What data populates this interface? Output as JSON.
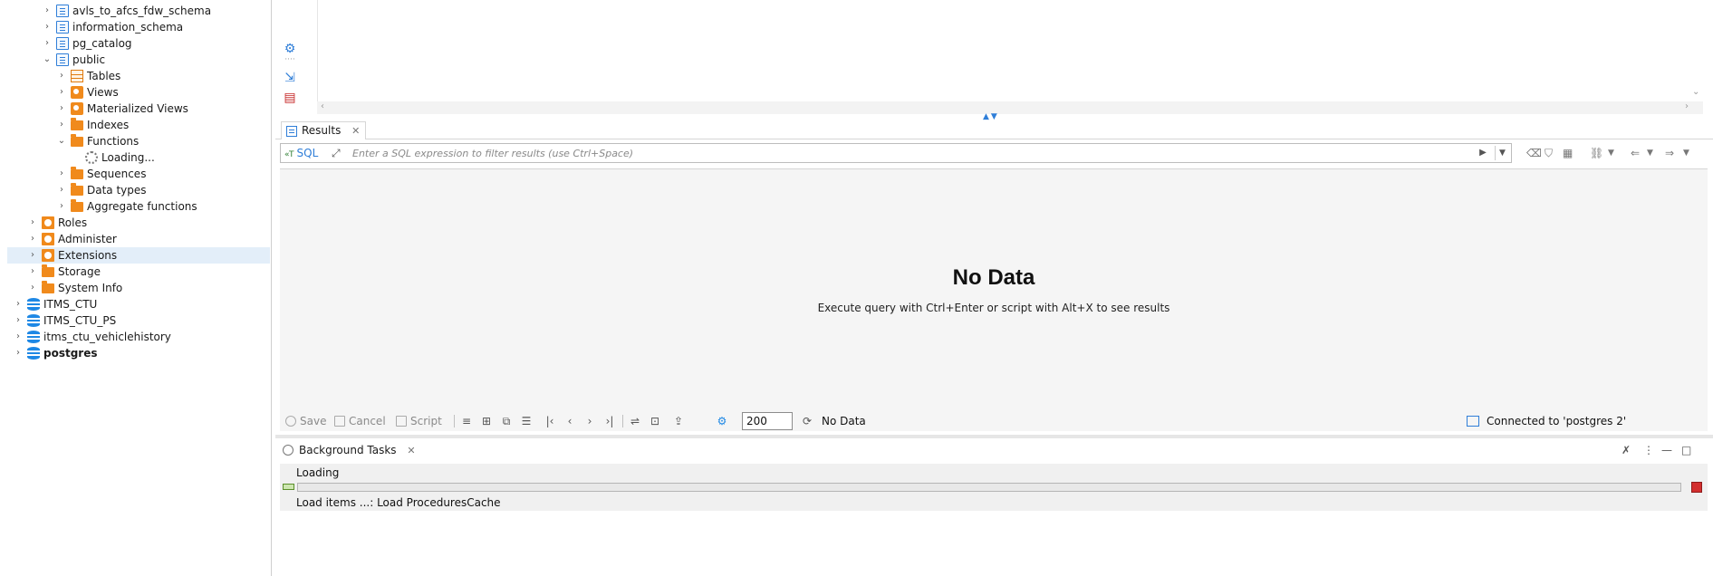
{
  "navigator": {
    "items": [
      {
        "label": "avls_to_afcs_fdw_schema",
        "icon": "schema-icon",
        "level": 3
      },
      {
        "label": "information_schema",
        "icon": "schema-icon",
        "level": 3
      },
      {
        "label": "pg_catalog",
        "icon": "schema-icon",
        "level": 3
      },
      {
        "label": "public",
        "icon": "schema-icon",
        "level": 3,
        "expanded": true
      },
      {
        "label": "Tables",
        "icon": "tables-icon",
        "level": 4
      },
      {
        "label": "Views",
        "icon": "view-icon",
        "level": 4
      },
      {
        "label": "Materialized Views",
        "icon": "view-icon",
        "level": 4
      },
      {
        "label": "Indexes",
        "icon": "folder-icon",
        "level": 4
      },
      {
        "label": "Functions",
        "icon": "folder-icon",
        "level": 4,
        "expanded": true
      },
      {
        "label": "Loading...",
        "icon": "loading-icon",
        "level": 5
      },
      {
        "label": "Sequences",
        "icon": "folder-icon",
        "level": 4
      },
      {
        "label": "Data types",
        "icon": "folder-icon",
        "level": 4
      },
      {
        "label": "Aggregate functions",
        "icon": "folder-icon",
        "level": 4
      },
      {
        "label": "Roles",
        "icon": "admin-icon",
        "level": 2
      },
      {
        "label": "Administer",
        "icon": "admin-icon",
        "level": 2
      },
      {
        "label": "Extensions",
        "icon": "admin-icon",
        "level": 2,
        "selected": true
      },
      {
        "label": "Storage",
        "icon": "folder-icon",
        "level": 2
      },
      {
        "label": "System Info",
        "icon": "folder-icon",
        "level": 2
      },
      {
        "label": "ITMS_CTU",
        "icon": "database-icon",
        "level": 1
      },
      {
        "label": "ITMS_CTU_PS",
        "icon": "database-icon",
        "level": 1
      },
      {
        "label": "itms_ctu_vehiclehistory",
        "icon": "database-icon",
        "level": 1
      },
      {
        "label": "postgres",
        "icon": "database-icon",
        "level": 1,
        "bold": true
      }
    ]
  },
  "results": {
    "tab_label": "Results",
    "sql_label": "SQL",
    "filter_placeholder": "Enter a SQL expression to filter results (use Ctrl+Space)",
    "empty_title": "No Data",
    "empty_hint": "Execute query with Ctrl+Enter or script with Alt+X to see results"
  },
  "statusbar": {
    "save_label": "Save",
    "cancel_label": "Cancel",
    "script_label": "Script",
    "row_limit": "200",
    "row_count_label": "No Data",
    "connection_status": "Connected to 'postgres 2'"
  },
  "background_tasks": {
    "tab_label": "Background Tasks",
    "task_name": "Loading",
    "task_detail": "Load items ...: Load ProceduresCache",
    "progress": 0
  },
  "colors": {
    "accent": "#2f7ed8",
    "folder": "#f08a1c",
    "selection": "#e3eef9",
    "stop": "#d32f2f"
  }
}
